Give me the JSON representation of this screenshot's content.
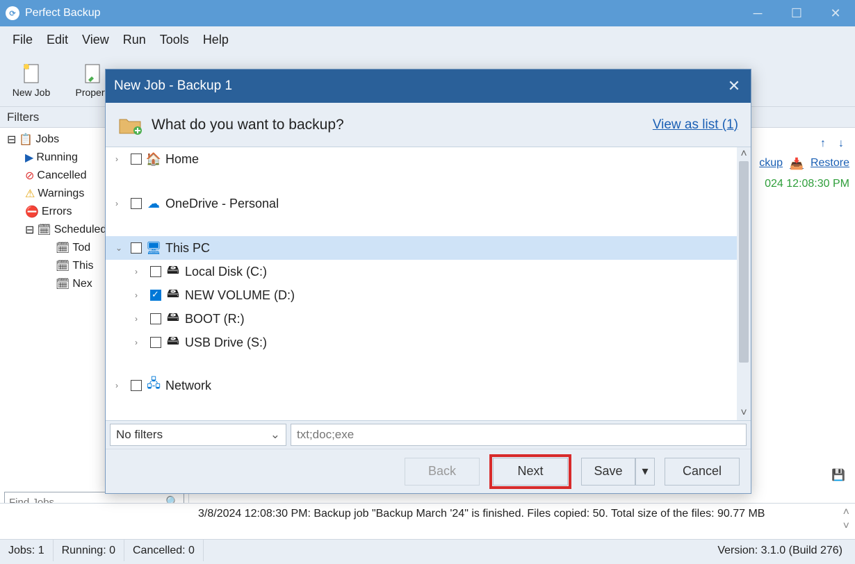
{
  "app": {
    "title": "Perfect Backup"
  },
  "menu": {
    "file": "File",
    "edit": "Edit",
    "view": "View",
    "run": "Run",
    "tools": "Tools",
    "help": "Help"
  },
  "toolbar": {
    "newjob": "New Job",
    "properties": "Properti"
  },
  "filters": {
    "header": "Filters"
  },
  "sidebar": {
    "jobs": "Jobs",
    "running": "Running",
    "cancelled": "Cancelled",
    "warnings": "Warnings",
    "errors": "Errors",
    "scheduled": "Scheduled",
    "today_trunc": "Tod",
    "this_trunc": "This",
    "next_trunc": "Nex",
    "find_placeholder": "Find Jobs..."
  },
  "rightpeek": {
    "ckup": "ckup",
    "restore": "Restore",
    "timestamp": "024 12:08:30 PM"
  },
  "log": {
    "line": "3/8/2024 12:08:30 PM: Backup job \"Backup March '24\" is finished. Files copied: 50. Total size of the files: 90.77 MB"
  },
  "status": {
    "jobs": "Jobs: 1",
    "running": "Running: 0",
    "cancelled": "Cancelled: 0",
    "version": "Version: 3.1.0 (Build 276)"
  },
  "dialog": {
    "title": "New Job - Backup 1",
    "heading": "What do you want to backup?",
    "viewlink": "View as list (1)",
    "tree": {
      "home": "Home",
      "onedrive": "OneDrive - Personal",
      "thispc": "This PC",
      "local_c": "Local Disk (C:)",
      "new_vol_d": "NEW VOLUME (D:)",
      "boot_r": "BOOT (R:)",
      "usb_s": "USB Drive (S:)",
      "network": "Network"
    },
    "filter": {
      "nofilters": "No filters",
      "placeholder": "txt;doc;exe"
    },
    "buttons": {
      "back": "Back",
      "next": "Next",
      "save": "Save",
      "cancel": "Cancel"
    }
  }
}
